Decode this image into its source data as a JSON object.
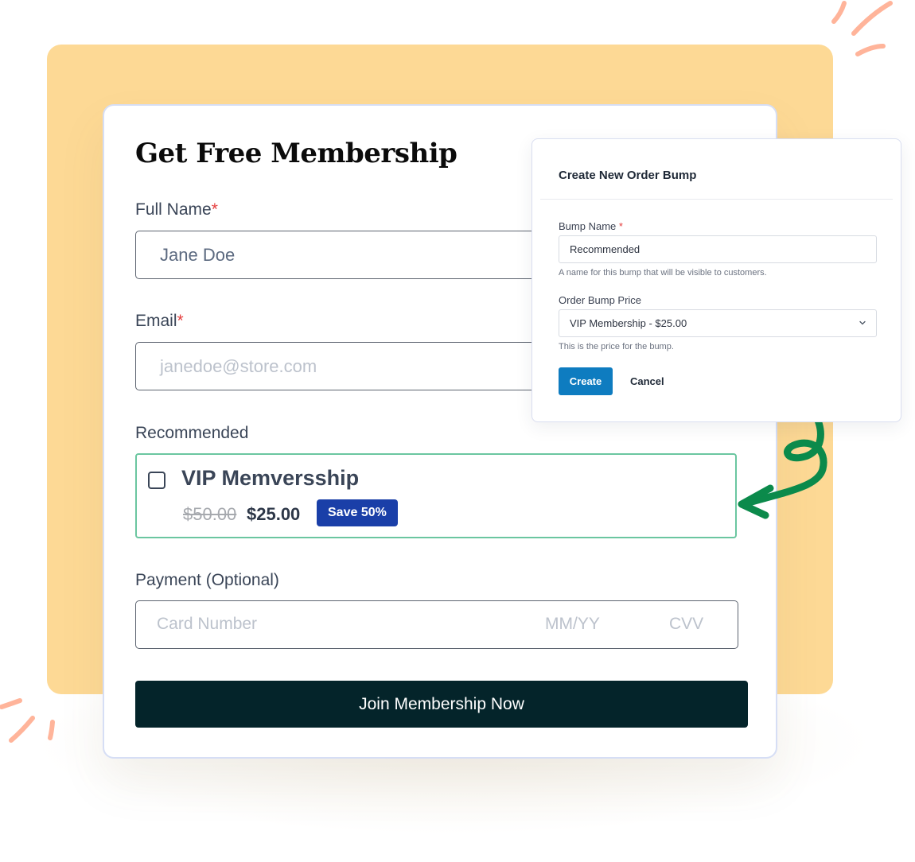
{
  "colors": {
    "background_block": "#fdd995",
    "doodle_stroke": "#ffb49a",
    "arrow_stroke": "#0b8a4b",
    "bump_border": "#6bc6a0",
    "badge_bg": "#1a3fa8",
    "join_button_bg": "#04242a",
    "create_button_bg": "#0e7cc0",
    "required_asterisk": "#e53e3e"
  },
  "form": {
    "title": "Get Free Membership",
    "full_name": {
      "label": "Full Name",
      "required_mark": "*",
      "value": "Jane Doe"
    },
    "email": {
      "label": "Email",
      "required_mark": "*",
      "placeholder": "janedoe@store.com"
    },
    "recommended": {
      "label": "Recommended",
      "checked": false,
      "product_name": "VIP Memversship",
      "original_price": "$50.00",
      "price": "$25.00",
      "badge": "Save 50%"
    },
    "payment": {
      "label": "Payment (Optional)",
      "card_placeholder": "Card Number",
      "expiry_placeholder": "MM/YY",
      "cvv_placeholder": "CVV"
    },
    "submit_label": "Join Membership Now"
  },
  "modal": {
    "title": "Create New Order Bump",
    "bump_name": {
      "label": "Bump Name",
      "required_mark": "*",
      "value": "Recommended",
      "help": "A name for this bump that will be visible to customers."
    },
    "price": {
      "label": "Order Bump Price",
      "selected": "VIP Membership - $25.00",
      "help": "This is the price for the bump."
    },
    "create_label": "Create",
    "cancel_label": "Cancel"
  }
}
